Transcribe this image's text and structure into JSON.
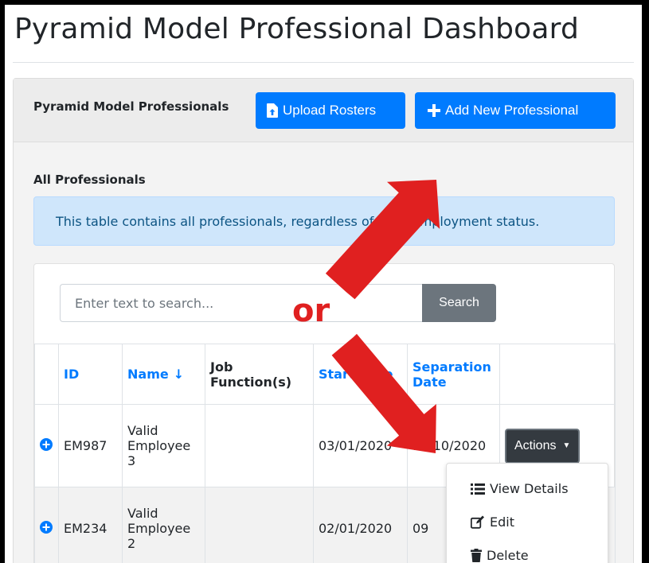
{
  "page": {
    "title": "Pyramid Model Professional Dashboard"
  },
  "header": {
    "title": "Pyramid Model Professionals",
    "upload_label": "Upload Rosters",
    "add_label": "Add New Professional"
  },
  "section": {
    "title": "All Professionals",
    "alert": "This table contains all professionals, regardless of their employment status."
  },
  "search": {
    "placeholder": "Enter text to search...",
    "button": "Search"
  },
  "table": {
    "columns": [
      "",
      "ID",
      "Name",
      "Job Function(s)",
      "Start Date",
      "Separation Date",
      ""
    ],
    "rows": [
      {
        "id": "EM987",
        "name": "Valid Employee 3",
        "job": "",
        "start": "03/01/2020",
        "separation": "10/10/2020",
        "action": "Actions"
      },
      {
        "id": "EM234",
        "name": "Valid Employee 2",
        "job": "",
        "start": "02/01/2020",
        "separation": "09",
        "action": ""
      }
    ]
  },
  "dropdown": {
    "items": [
      "View Details",
      "Edit",
      "Delete"
    ]
  },
  "annotation": {
    "text": "or",
    "color": "#e02020"
  },
  "colors": {
    "primary": "#007bff",
    "secondary": "#6c757d",
    "dark": "#343a40",
    "info_bg": "#cfe6fb"
  }
}
